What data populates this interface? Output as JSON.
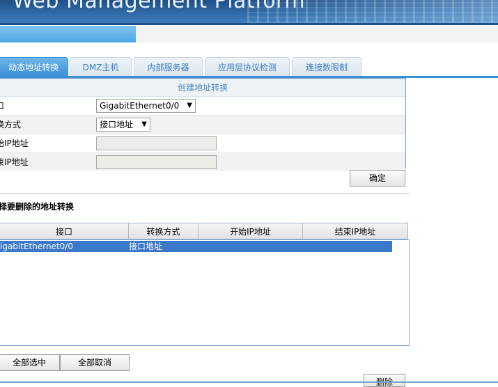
{
  "header": {
    "title": "Web Management Platform"
  },
  "progress": {
    "fraction": 0.273
  },
  "tabs": [
    {
      "label": "动态地址转换",
      "active": true
    },
    {
      "label": "DMZ主机",
      "active": false
    },
    {
      "label": "内部服务器",
      "active": false
    },
    {
      "label": "应用层协议检测",
      "active": false
    },
    {
      "label": "连接数限制",
      "active": false
    }
  ],
  "create": {
    "caption": "创建地址转换",
    "interface_label": "口",
    "interface_value": "GigabitEthernet0/0",
    "mode_label": "换方式",
    "mode_value": "接口地址",
    "start_ip_label": "始IP地址",
    "end_ip_label": "束IP地址",
    "start_ip_value": "",
    "end_ip_value": "",
    "confirm_label": "确定"
  },
  "delete_section": {
    "title": "择要删除的地址转换",
    "columns": [
      "接口",
      "转换方式",
      "开始IP地址",
      "结束IP地址"
    ],
    "rows": [
      {
        "interface": "igabitEthernet0/0",
        "mode": "接口地址",
        "start_ip": "",
        "end_ip": "",
        "selected": true
      }
    ],
    "select_all_label": "全部选中",
    "deselect_all_label": "全部取消",
    "delete_label": "删除"
  },
  "colors": {
    "accent": "#3a8fd6",
    "selected_row": "#3a78c9",
    "tab_text": "#3c7cc0"
  }
}
